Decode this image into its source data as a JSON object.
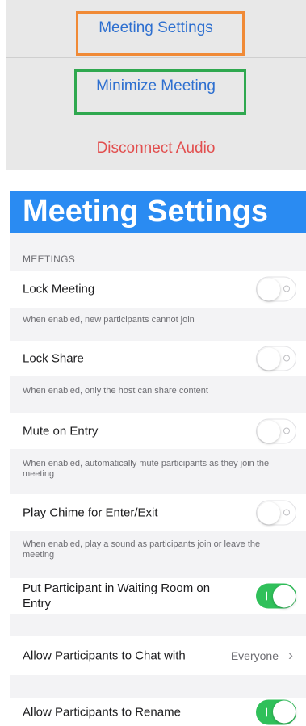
{
  "menu": {
    "items": [
      {
        "label": "Meeting Settings",
        "color": "#2d6fd0"
      },
      {
        "label": "Minimize Meeting",
        "color": "#2d6fd0"
      },
      {
        "label": "Disconnect Audio",
        "color": "#e24f4f"
      }
    ],
    "highlight_colors": {
      "orange": "#f08a36",
      "green": "#2fa84f"
    }
  },
  "settings": {
    "title": "Meeting Settings",
    "section_header": "MEETINGS",
    "rows": [
      {
        "label": "Lock Meeting",
        "toggle": "off",
        "description": "When enabled, new participants cannot join"
      },
      {
        "label": "Lock Share",
        "toggle": "off",
        "description": "When enabled, only the host can share content"
      },
      {
        "label": "Mute on Entry",
        "toggle": "off",
        "description": "When enabled, automatically mute participants as they join the meeting"
      },
      {
        "label": "Play Chime for Enter/Exit",
        "toggle": "off",
        "description": "When enabled, play a sound as participants join or leave the meeting"
      },
      {
        "label": "Put Participant in Waiting Room on Entry",
        "toggle": "on"
      },
      {
        "label": "Allow Participants to Chat with",
        "value": "Everyone",
        "icon": "chevron-right-icon"
      },
      {
        "label": "Allow Participants to Rename",
        "toggle": "on"
      }
    ],
    "accent_color": "#2a8bf2",
    "toggle_on_color": "#30c05a"
  }
}
